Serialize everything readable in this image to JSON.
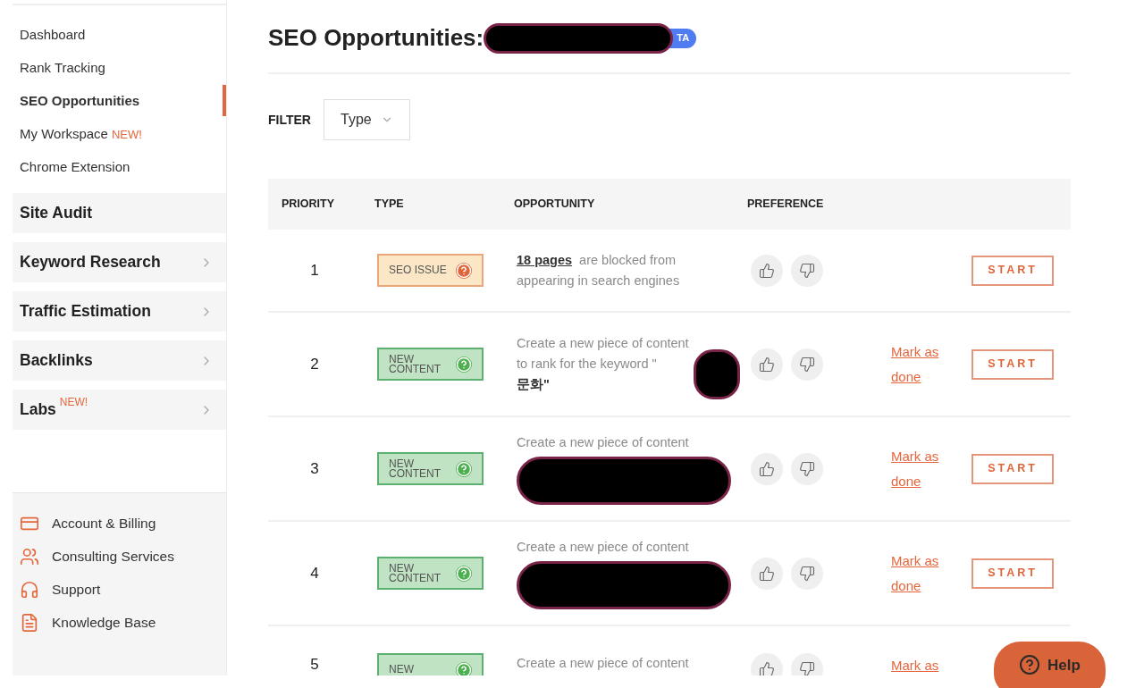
{
  "sidebar": {
    "items": [
      {
        "label": "Dashboard",
        "selected": false
      },
      {
        "label": "Rank Tracking",
        "selected": false
      },
      {
        "label": "SEO Opportunities",
        "selected": true
      },
      {
        "label": "My Workspace",
        "badge": "NEW!",
        "selected": false
      },
      {
        "label": "Chrome Extension",
        "selected": false
      }
    ],
    "sections": [
      {
        "label": "Site Audit",
        "expandable": false
      },
      {
        "label": "Keyword Research",
        "expandable": true
      },
      {
        "label": "Traffic Estimation",
        "expandable": true
      },
      {
        "label": "Backlinks",
        "expandable": true
      },
      {
        "label": "Labs",
        "badge": "NEW!",
        "expandable": true
      }
    ],
    "footer_links": [
      {
        "label": "Account & Billing"
      },
      {
        "label": "Consulting Services"
      },
      {
        "label": "Support"
      },
      {
        "label": "Knowledge Base"
      }
    ]
  },
  "header": {
    "title": "SEO Opportunities:",
    "badge": "TA"
  },
  "filter": {
    "label": "FILTER",
    "dropdown": "Type"
  },
  "table": {
    "columns": [
      "PRIORITY",
      "TYPE",
      "OPPORTUNITY",
      "PREFERENCE"
    ],
    "rows": [
      {
        "priority": "1",
        "type": {
          "kind": "issue",
          "label": "SEO ISSUE"
        },
        "opportunity": [
          {
            "kind": "link",
            "text": "18 pages"
          },
          {
            "kind": "text",
            "text": "are blocked from appearing in search engines"
          }
        ],
        "start": "START"
      },
      {
        "priority": "2",
        "type": {
          "kind": "content",
          "label": "NEW CONTENT"
        },
        "opportunity": [
          {
            "kind": "text",
            "text": "Create a new piece of content to rank for the keyword \""
          },
          {
            "kind": "dot"
          },
          {
            "kind": "strong",
            "text": "문화\""
          }
        ],
        "mark": "Mark as done",
        "start": "START"
      },
      {
        "priority": "3",
        "type": {
          "kind": "content",
          "label": "NEW CONTENT"
        },
        "opportunity": [
          {
            "kind": "text",
            "text": "Create a new piece of content"
          },
          {
            "kind": "bar"
          }
        ],
        "mark": "Mark as done",
        "start": "START"
      },
      {
        "priority": "4",
        "type": {
          "kind": "content",
          "label": "NEW CONTENT"
        },
        "opportunity": [
          {
            "kind": "text",
            "text": "Create a new piece of content"
          },
          {
            "kind": "bar"
          }
        ],
        "mark": "Mark as done",
        "start": "START"
      },
      {
        "priority": "5",
        "type": {
          "kind": "content",
          "label": "NEW"
        },
        "opportunity": [
          {
            "kind": "text",
            "text": "Create a new piece of content"
          }
        ],
        "mark": "Mark as",
        "partial": true
      }
    ]
  },
  "help": {
    "label": "Help"
  }
}
